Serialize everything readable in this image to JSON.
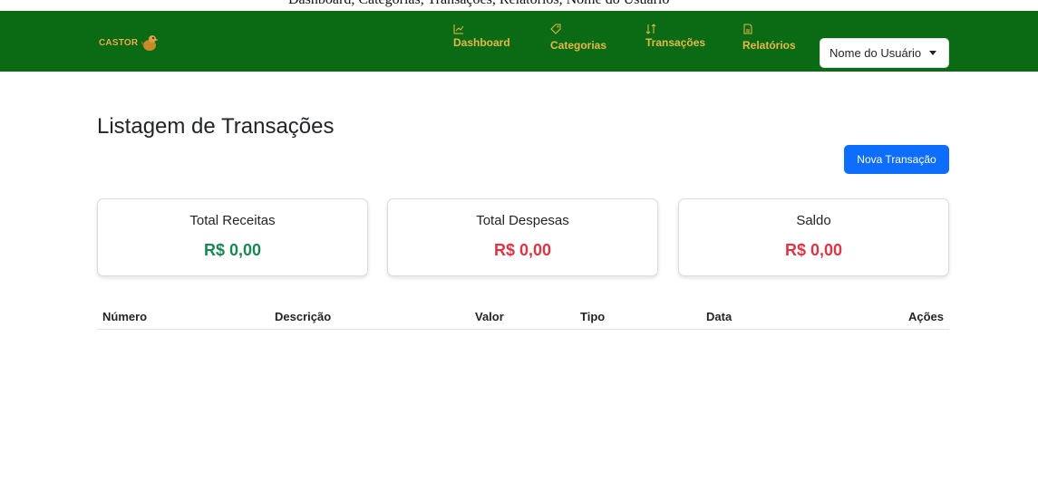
{
  "navbar": {
    "brand_text": "CASTOR",
    "brand_icon": "castor-bird-logo",
    "items": [
      {
        "label": "Dashboard",
        "icon": "chart-line-icon"
      },
      {
        "label": "Categorias",
        "icon": "tag-icon"
      },
      {
        "label": "Transações",
        "icon": "sort-arrows-icon"
      },
      {
        "label": "Relatórios",
        "icon": "document-icon"
      }
    ],
    "user_dropdown": "Nome do Usuário"
  },
  "top_strip_text": "Dashboard, Categorias, Transações, Relatórios, Nome do Usuário",
  "main": {
    "title": "Listagem de Transações",
    "new_button": "Nova Transação",
    "cards": [
      {
        "title": "Total Receitas",
        "value": "R$ 0,00",
        "color": "#198754"
      },
      {
        "title": "Total Despesas",
        "value": "R$ 0,00",
        "color": "#dc3545"
      },
      {
        "title": "Saldo",
        "value": "R$ 0,00",
        "color": "#dc3545"
      }
    ],
    "table": {
      "columns": [
        "Número",
        "Descrição",
        "Valor",
        "Tipo",
        "Data",
        "Ações"
      ]
    }
  },
  "colors": {
    "navbar_bg": "#0a6b14",
    "nav_text": "#e4b84a",
    "primary": "#0d6efd"
  }
}
